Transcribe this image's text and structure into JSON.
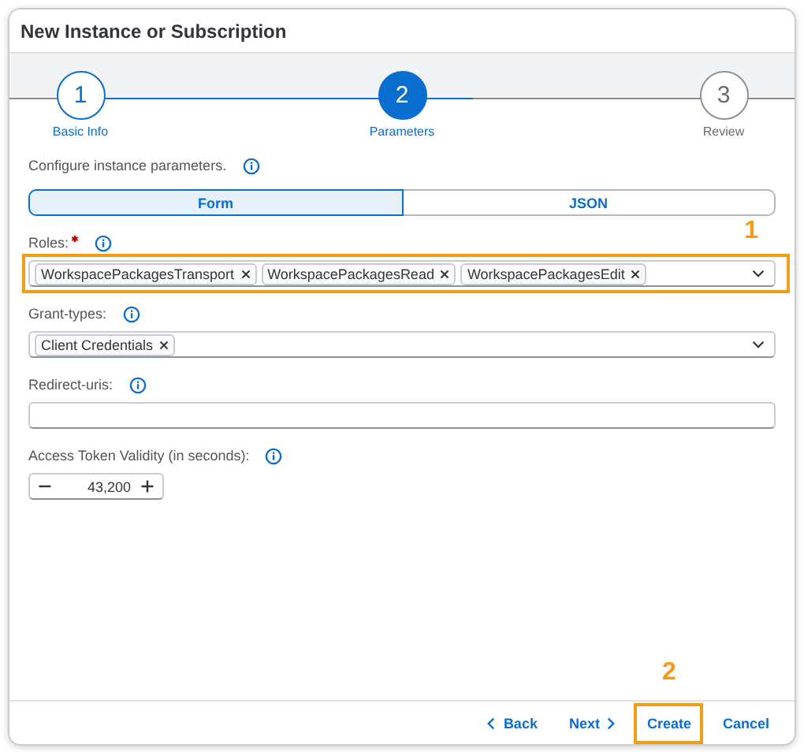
{
  "dialog": {
    "title": "New Instance or Subscription"
  },
  "steps": [
    {
      "number": "1",
      "label": "Basic Info",
      "selected": false
    },
    {
      "number": "2",
      "label": "Parameters",
      "selected": true
    },
    {
      "number": "3",
      "label": "Review",
      "selected": false
    }
  ],
  "intro": "Configure instance parameters.",
  "mode_tabs": [
    {
      "label": "Form",
      "selected": true
    },
    {
      "label": "JSON",
      "selected": false
    }
  ],
  "fields": [
    {
      "kind": "tokens",
      "label": "Roles:",
      "required": true,
      "callout": "1",
      "tokens": [
        "WorkspacePackagesTransport",
        "WorkspacePackagesRead",
        "WorkspacePackagesEdit"
      ]
    },
    {
      "kind": "tokens",
      "label": "Grant-types:",
      "required": false,
      "tokens": [
        "Client Credentials"
      ]
    },
    {
      "kind": "text",
      "label": "Redirect-uris:",
      "required": false
    },
    {
      "kind": "stepper",
      "label": "Access Token Validity (in seconds):",
      "required": false,
      "value": "43,200"
    }
  ],
  "footer_buttons": [
    {
      "kind": "back",
      "label": "Back"
    },
    {
      "kind": "next",
      "label": "Next"
    },
    {
      "kind": "plain",
      "label": "Create",
      "callout": "2"
    },
    {
      "kind": "plain",
      "label": "Cancel"
    }
  ]
}
